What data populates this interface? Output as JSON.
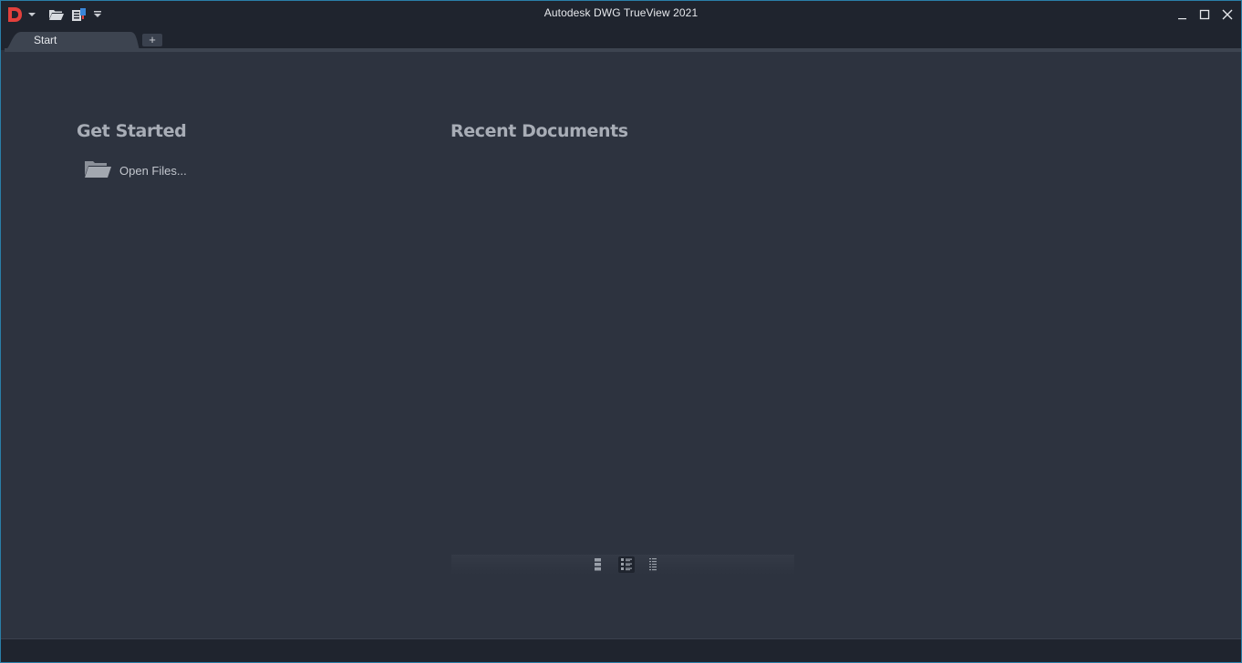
{
  "titlebar": {
    "title": "Autodesk DWG TrueView 2021",
    "app_logo_letter": "D"
  },
  "tabs": {
    "start_label": "Start",
    "add_label": "+"
  },
  "get_started": {
    "heading": "Get Started",
    "open_files_label": "Open Files..."
  },
  "recent": {
    "heading": "Recent Documents"
  },
  "colors": {
    "accent_logo": "#e2403c",
    "background": "#2d333f",
    "chrome": "#1f242e"
  }
}
